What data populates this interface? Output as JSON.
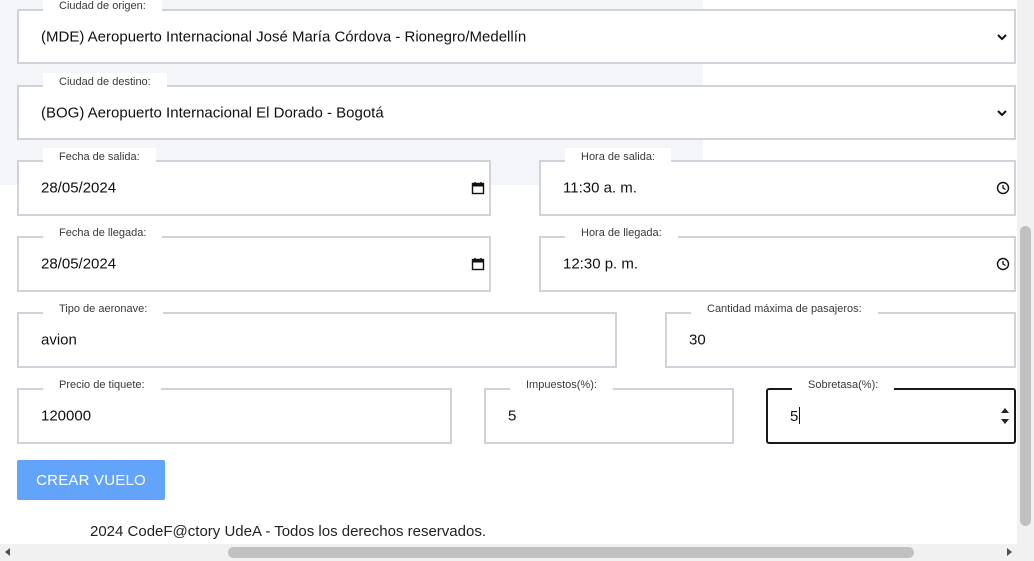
{
  "form": {
    "origin": {
      "label": "Ciudad de origen:",
      "value": "(MDE) Aeropuerto Internacional José María Córdova - Rionegro/Medellín"
    },
    "destination": {
      "label": "Ciudad de destino:",
      "value": "(BOG) Aeropuerto Internacional El Dorado - Bogotá"
    },
    "departure_date": {
      "label": "Fecha de salida:",
      "value": "28/05/2024"
    },
    "departure_time": {
      "label": "Hora de salida:",
      "value": "11:30  a. m."
    },
    "arrival_date": {
      "label": "Fecha de llegada:",
      "value": "28/05/2024"
    },
    "arrival_time": {
      "label": "Hora de llegada:",
      "value": "12:30  p. m."
    },
    "aircraft_type": {
      "label": "Tipo de aeronave:",
      "value": "avion"
    },
    "max_passengers": {
      "label": "Cantidad máxima de pasajeros:",
      "value": "30"
    },
    "ticket_price": {
      "label": "Precio de tiquete:",
      "value": "120000"
    },
    "taxes": {
      "label": "Impuestos(%):",
      "value": "5"
    },
    "surcharge": {
      "label": "Sobretasa(%):",
      "value": "5"
    }
  },
  "submit_label": "CREAR VUELO",
  "footer_text": "2024 CodeF@ctory UdeA - Todos los derechos reservados.",
  "colors": {
    "button": "#63a4fb",
    "border": "#cfd2d8",
    "focus_border": "#1a1a1a"
  },
  "icons": {
    "select": "chevron-down-icon",
    "date": "calendar-icon",
    "time": "clock-icon",
    "number": "spinner-icon"
  }
}
